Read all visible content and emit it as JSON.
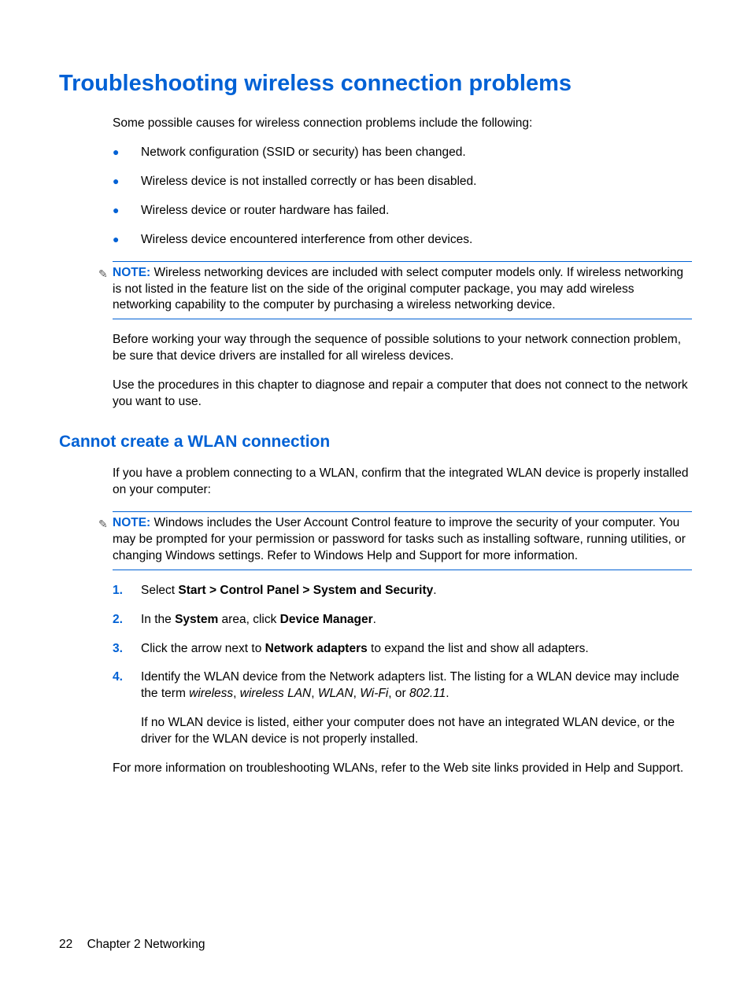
{
  "h1": "Troubleshooting wireless connection problems",
  "intro": "Some possible causes for wireless connection problems include the following:",
  "bullets": [
    "Network configuration (SSID or security) has been changed.",
    "Wireless device is not installed correctly or has been disabled.",
    "Wireless device or router hardware has failed.",
    "Wireless device encountered interference from other devices."
  ],
  "note1_label": "NOTE:",
  "note1_text": "Wireless networking devices are included with select computer models only. If wireless networking is not listed in the feature list on the side of the original computer package, you may add wireless networking capability to the computer by purchasing a wireless networking device.",
  "para_before": "Before working your way through the sequence of possible solutions to your network connection problem, be sure that device drivers are installed for all wireless devices.",
  "para_use": "Use the procedures in this chapter to diagnose and repair a computer that does not connect to the network you want to use.",
  "h2": "Cannot create a WLAN connection",
  "para_wlan": "If you have a problem connecting to a WLAN, confirm that the integrated WLAN device is properly installed on your computer:",
  "note2_label": "NOTE:",
  "note2_text": "Windows includes the User Account Control feature to improve the security of your computer. You may be prompted for your permission or password for tasks such as installing software, running utilities, or changing Windows settings. Refer to Windows Help and Support for more information.",
  "step1_a": "Select ",
  "step1_b": "Start > Control Panel > System and Security",
  "step1_c": ".",
  "step2_a": "In the ",
  "step2_b": "System",
  "step2_c": " area, click ",
  "step2_d": "Device Manager",
  "step2_e": ".",
  "step3_a": "Click the arrow next to ",
  "step3_b": "Network adapters",
  "step3_c": " to expand the list and show all adapters.",
  "step4_a": "Identify the WLAN device from the Network adapters list. The listing for a WLAN device may include the term ",
  "step4_i1": "wireless",
  "step4_s1": ", ",
  "step4_i2": "wireless LAN",
  "step4_s2": ", ",
  "step4_i3": "WLAN",
  "step4_s3": ", ",
  "step4_i4": "Wi-Fi",
  "step4_s4": ", or ",
  "step4_i5": "802.11",
  "step4_s5": ".",
  "step4_extra": "If no WLAN device is listed, either your computer does not have an integrated WLAN device, or the driver for the WLAN device is not properly installed.",
  "para_more": "For more information on troubleshooting WLANs, refer to the Web site links provided in Help and Support.",
  "footer_page": "22",
  "footer_chapter": "Chapter 2   Networking",
  "num1": "1.",
  "num2": "2.",
  "num3": "3.",
  "num4": "4.",
  "dot": "●",
  "note_icon": "✎"
}
